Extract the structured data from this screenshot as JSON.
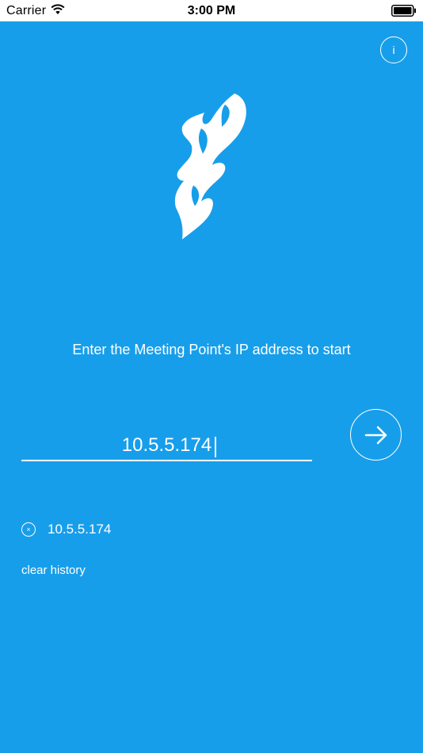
{
  "status_bar": {
    "carrier": "Carrier",
    "time": "3:00 PM",
    "wifi_icon": "wifi-icon",
    "battery_icon": "battery-icon"
  },
  "colors": {
    "background": "#179eea",
    "foreground": "#ffffff"
  },
  "header": {
    "info_label": "i"
  },
  "logo": {
    "icon": "flame-logo"
  },
  "main": {
    "prompt": "Enter the Meeting Point's IP address to start",
    "ip_input_value": "10.5.5.174",
    "go_icon": "arrow-right-icon"
  },
  "history": {
    "items": [
      {
        "ip": "10.5.5.174",
        "remove_glyph": "×"
      }
    ],
    "clear_label": "clear history"
  }
}
